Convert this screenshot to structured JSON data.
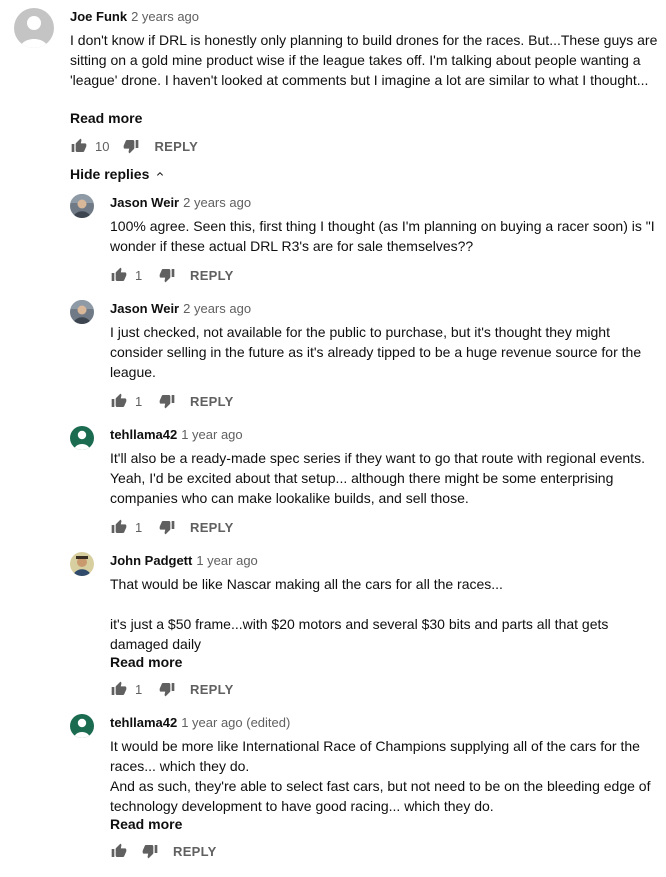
{
  "reply_label": "REPLY",
  "read_more_label": "Read more",
  "hide_replies_label": "Hide replies",
  "top_comment": {
    "author": "Joe Funk",
    "time": "2 years ago",
    "text": "I don't know if DRL is honestly only planning to build drones for the races.  But...These guys are sitting on a gold mine product wise if the league takes off.  I'm talking about people wanting a 'league' drone.  I haven't looked at comments but I imagine a lot are similar to what I thought...",
    "likes": "10"
  },
  "replies": [
    {
      "author": "Jason Weir",
      "time": "2 years ago",
      "text": "100% agree. Seen this, first thing I thought (as I'm planning on buying a racer soon) is \"I wonder if these actual DRL R3's are for sale themselves??",
      "likes": "1"
    },
    {
      "author": "Jason Weir",
      "time": "2 years ago",
      "text": "I just checked, not available for the public to purchase, but it's thought they might consider selling in the future as it's already tipped to be a huge revenue source for the league.",
      "likes": "1"
    },
    {
      "author": "tehllama42",
      "time": "1 year ago",
      "text": "It'll also be a ready-made spec series if they want to go that route with regional events.  Yeah, I'd be excited about that setup... although there might be some enterprising companies who can make lookalike builds, and sell those.",
      "likes": "1"
    },
    {
      "author": "John Padgett",
      "time": "1 year ago",
      "text": "That would be like Nascar making all the cars for all the races...\n\nit's just a $50 frame...with $20 motors and several $30 bits and parts all that gets damaged daily",
      "likes": "1"
    },
    {
      "author": "tehllama42",
      "time": "1 year ago (edited)",
      "text": "It would be more like International Race of Champions supplying all of the cars for the races... which they do.\nAnd as such, they're able to select fast cars, but not need to be on the bleeding edge of technology development to have good racing... which they do.",
      "likes": ""
    }
  ],
  "colors": {
    "text": "#0f0f0f",
    "secondary": "#606060",
    "avatar_gray": "#c4c4c4",
    "avatar_green": "#1a6b4f"
  }
}
